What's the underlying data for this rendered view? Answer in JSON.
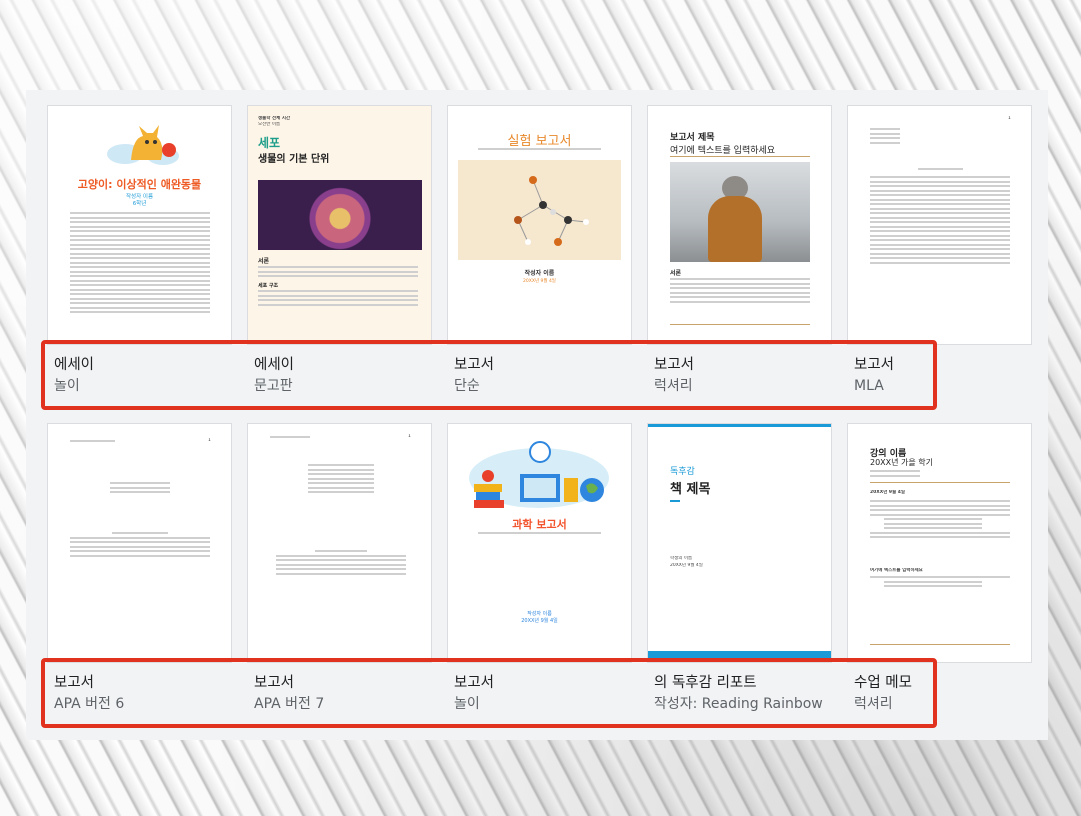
{
  "templates": [
    {
      "category": "에세이",
      "style": "놀이",
      "title": "고양이: 이상적인 애완동물",
      "author": "작성자 이름",
      "subtitle": "6학년"
    },
    {
      "category": "에세이",
      "style": "문고판",
      "kicker": "생물학 전체 시간",
      "kicker2": "오전반 이름",
      "title": "세포",
      "subtitle": "생물의 기본 단위",
      "section1": "서론",
      "section2": "세포 구조"
    },
    {
      "category": "보고서",
      "style": "단순",
      "title": "실험 보고서",
      "author": "작성자 이름",
      "date": "20XX년 9월 4일"
    },
    {
      "category": "보고서",
      "style": "럭셔리",
      "title_small": "보고서 제목",
      "title": "여기에 텍스트를 입력하세요",
      "section": "서론"
    },
    {
      "category": "보고서",
      "style": "MLA",
      "page_no": "1"
    },
    {
      "category": "보고서",
      "style": "APA 버전 6",
      "page_no": "1"
    },
    {
      "category": "보고서",
      "style": "APA 버전 7",
      "page_no": "1"
    },
    {
      "category": "보고서",
      "style": "놀이",
      "title": "과학 보고서",
      "author": "작성자 이름",
      "date": "20XX년 9월 4일"
    },
    {
      "category": "의 독후감 리포트",
      "style": "작성자: Reading Rainbow",
      "kicker": "독후감",
      "title": "책 제목",
      "author": "학생의 이름",
      "date": "20XX년 9월 4일"
    },
    {
      "category": "수업 메모",
      "style": "럭셔리",
      "title": "강의 이름",
      "subtitle": "20XX년 가을 학기",
      "date_heading": "20XX년 9월 4일",
      "section": "여기에 텍스트를 입력하세요"
    }
  ],
  "colors": {
    "highlight": "#e0321f",
    "cat_title": "#ee5a24",
    "cell_title": "#1e9e8a",
    "lab_title": "#e8892b",
    "science_title": "#f2542d",
    "book_accent": "#1a9ad7"
  }
}
